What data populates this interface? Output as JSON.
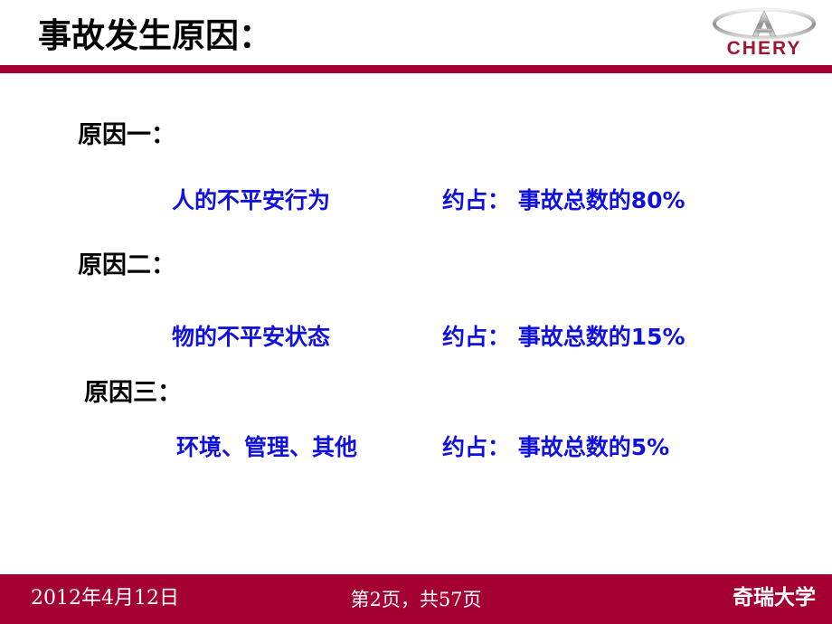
{
  "slide": {
    "title": "事故发生原因：",
    "brand": {
      "logo_icon": "chery-emblem-icon",
      "wordmark": "CHERY"
    },
    "colors": {
      "accent_crimson": "#a50034",
      "title_black": "#000000",
      "highlight_blue": "#1111dd",
      "logo_word_red": "#9c1733"
    },
    "causes": [
      {
        "label": "原因一：",
        "description": "人的不平安行为",
        "share": "约占：  事故总数的80%"
      },
      {
        "label": "原因二：",
        "description": "物的不平安状态",
        "share": "约占：  事故总数的15%"
      },
      {
        "label": "原因三：",
        "description": "环境、管理、其他",
        "share": "约占：  事故总数的5%"
      }
    ],
    "footer": {
      "date": "2012年4月12日",
      "page": "第2页，共57页",
      "organization": "奇瑞大学"
    }
  }
}
